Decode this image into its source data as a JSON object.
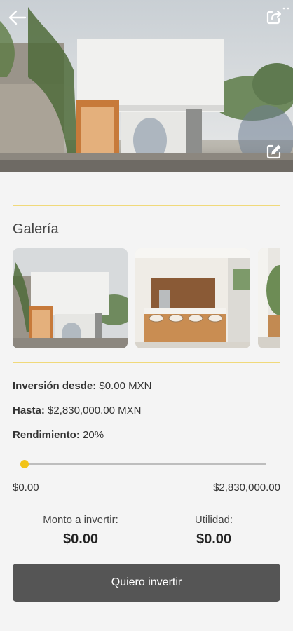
{
  "header": {
    "back_icon": "arrow-left-icon",
    "share_icon": "share-icon",
    "edit_icon": "edit-icon"
  },
  "gallery": {
    "title": "Galería",
    "images": [
      "house-exterior",
      "kitchen-interior",
      "garden-view"
    ]
  },
  "investment": {
    "from_label": "Inversión desde:",
    "from_value": "$0.00 MXN",
    "to_label": "Hasta:",
    "to_value": "$2,830,000.00 MXN",
    "yield_label": "Rendimiento:",
    "yield_value": "20%"
  },
  "slider": {
    "min_label": "$0.00",
    "max_label": "$2,830,000.00",
    "value_fraction": 0
  },
  "summary": {
    "amount_label": "Monto a invertir:",
    "amount_value": "$0.00",
    "profit_label": "Utilidad:",
    "profit_value": "$0.00"
  },
  "cta": {
    "label": "Quiero invertir"
  },
  "colors": {
    "accent": "#f2c318",
    "button": "#555555",
    "divider": "#f0d97a"
  }
}
